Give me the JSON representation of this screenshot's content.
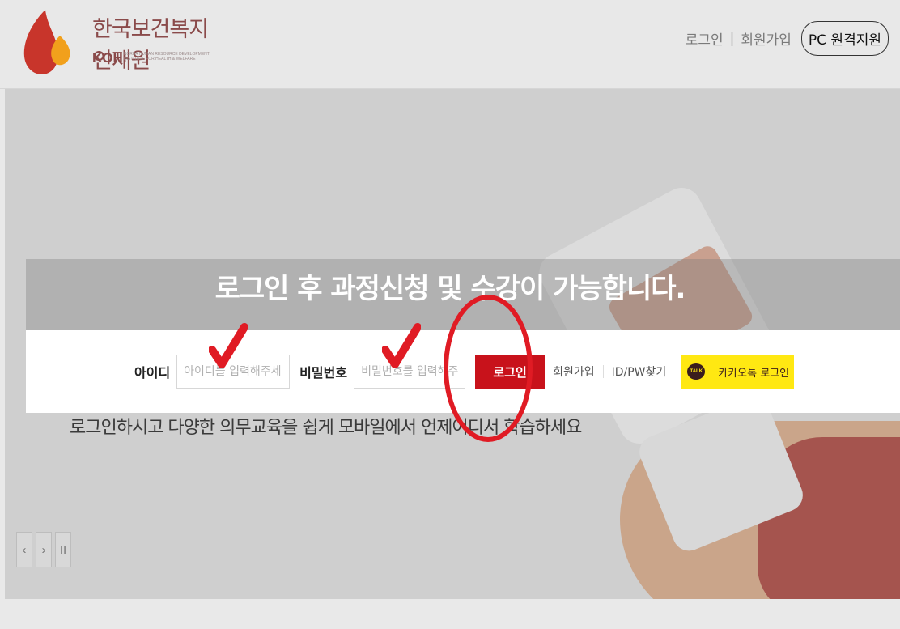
{
  "header": {
    "logo_title": "한국보건복지인재원",
    "logo_en": "KOHI",
    "logo_tiny": "KOREA HUMAN RESOURCE DEVELOPMENT INSTITUTE FOR HEALTH & WELFARE",
    "links": [
      "로그인",
      "회원가입"
    ],
    "pc_support": "PC 원격지원"
  },
  "hero": {
    "subtitle": "로그인하시고 다양한 의무교육을 쉽게 모바일에서 언제어디서 학습하세요"
  },
  "overlay": {
    "title": "로그인 후 과정신청 및 수강이 가능합니다."
  },
  "login": {
    "id_label": "아이디",
    "id_placeholder": "아이디를 입력해주세요",
    "pw_label": "비밀번호",
    "pw_placeholder": "비밀번호를 입력해주세요",
    "login_button": "로그인",
    "signup_link": "회원가입",
    "find_link": "ID/PW찾기",
    "kakao_badge": "TALK",
    "kakao_button": "카카오톡 로그인"
  },
  "slider": {
    "prev": "‹",
    "next": "›",
    "pause": "II"
  },
  "colors": {
    "accent_red": "#c8121b",
    "kakao_yellow": "#ffe812",
    "annotation_red": "#e01b24"
  }
}
